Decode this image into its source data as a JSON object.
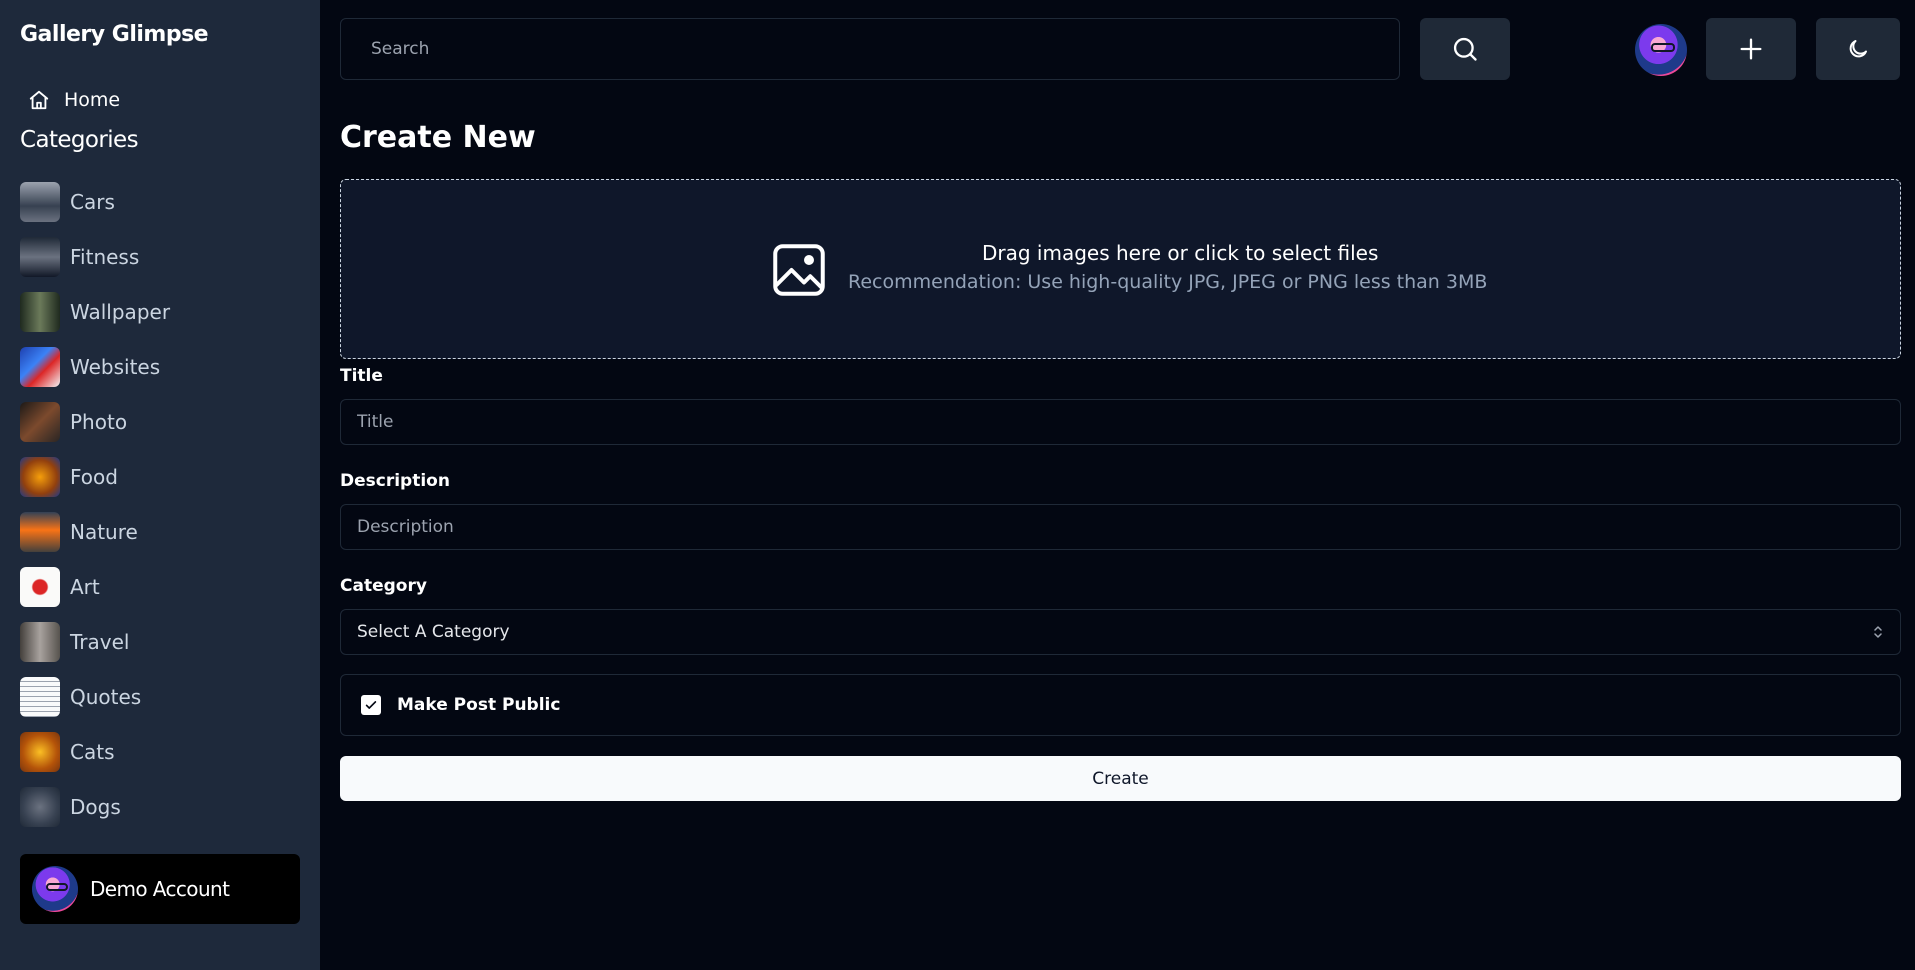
{
  "app": {
    "title": "Gallery Glimpse"
  },
  "sidebar": {
    "home_label": "Home",
    "categories_heading": "Categories",
    "categories": [
      {
        "label": "Cars",
        "thumb_color": "#4b5563"
      },
      {
        "label": "Fitness",
        "thumb_color": "#374151"
      },
      {
        "label": "Wallpaper",
        "thumb_color": "#3f4a3a"
      },
      {
        "label": "Websites",
        "thumb_color": "#1d4ed8"
      },
      {
        "label": "Photo",
        "thumb_color": "#5b3a2a"
      },
      {
        "label": "Food",
        "thumb_color": "#b7791f"
      },
      {
        "label": "Nature",
        "thumb_color": "#7c5a3a"
      },
      {
        "label": "Art",
        "thumb_color": "#f5f5f4"
      },
      {
        "label": "Travel",
        "thumb_color": "#6b5b4b"
      },
      {
        "label": "Quotes",
        "thumb_color": "#f3f4f6"
      },
      {
        "label": "Cats",
        "thumb_color": "#c08a3e"
      },
      {
        "label": "Dogs",
        "thumb_color": "#4b5563"
      }
    ],
    "account_name": "Demo Account"
  },
  "header": {
    "search_placeholder": "Search",
    "icons": [
      "search-icon",
      "plus-icon",
      "moon-icon"
    ]
  },
  "main": {
    "page_title": "Create New",
    "dropzone": {
      "primary_text": "Drag images here or click to select files",
      "secondary_text": "Recommendation: Use high-quality JPG, JPEG or PNG less than 3MB"
    },
    "title_label": "Title",
    "title_placeholder": "Title",
    "description_label": "Description",
    "description_placeholder": "Description",
    "category_label": "Category",
    "category_value": "Select A Category",
    "public_label": "Make Post Public",
    "public_checked": true,
    "create_label": "Create"
  },
  "colors": {
    "background": "#030712",
    "sidebar": "#1e293b",
    "button": "#1f2937",
    "primary_button": "#f8fafc"
  }
}
